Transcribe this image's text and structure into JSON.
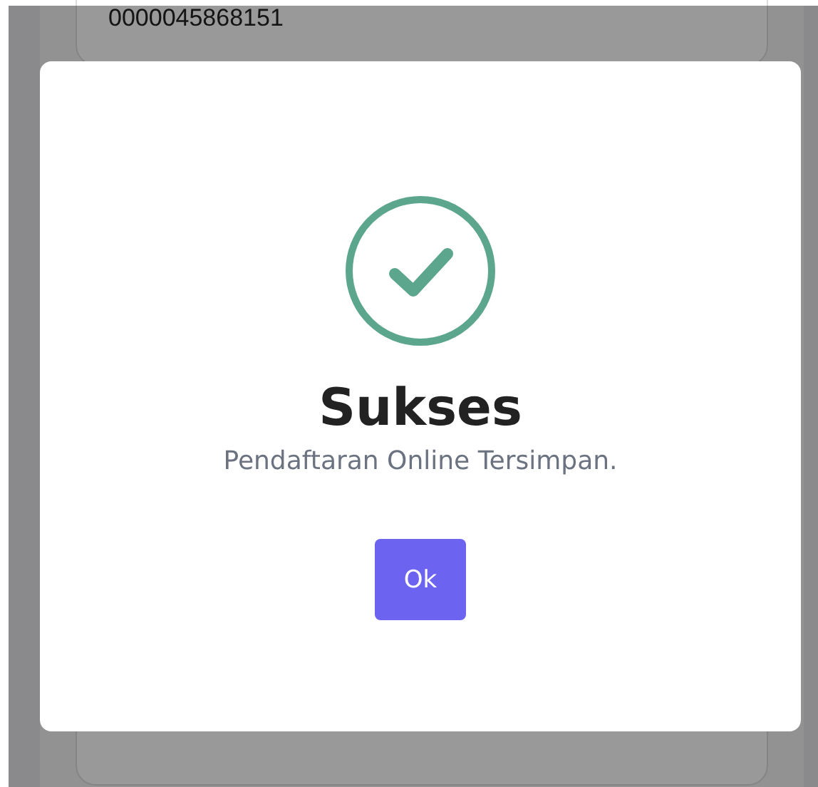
{
  "background_card": {
    "value": "0000045868151"
  },
  "dialog": {
    "title": "Sukses",
    "message": "Pendaftaran Online Tersimpan.",
    "button": "Ok"
  }
}
